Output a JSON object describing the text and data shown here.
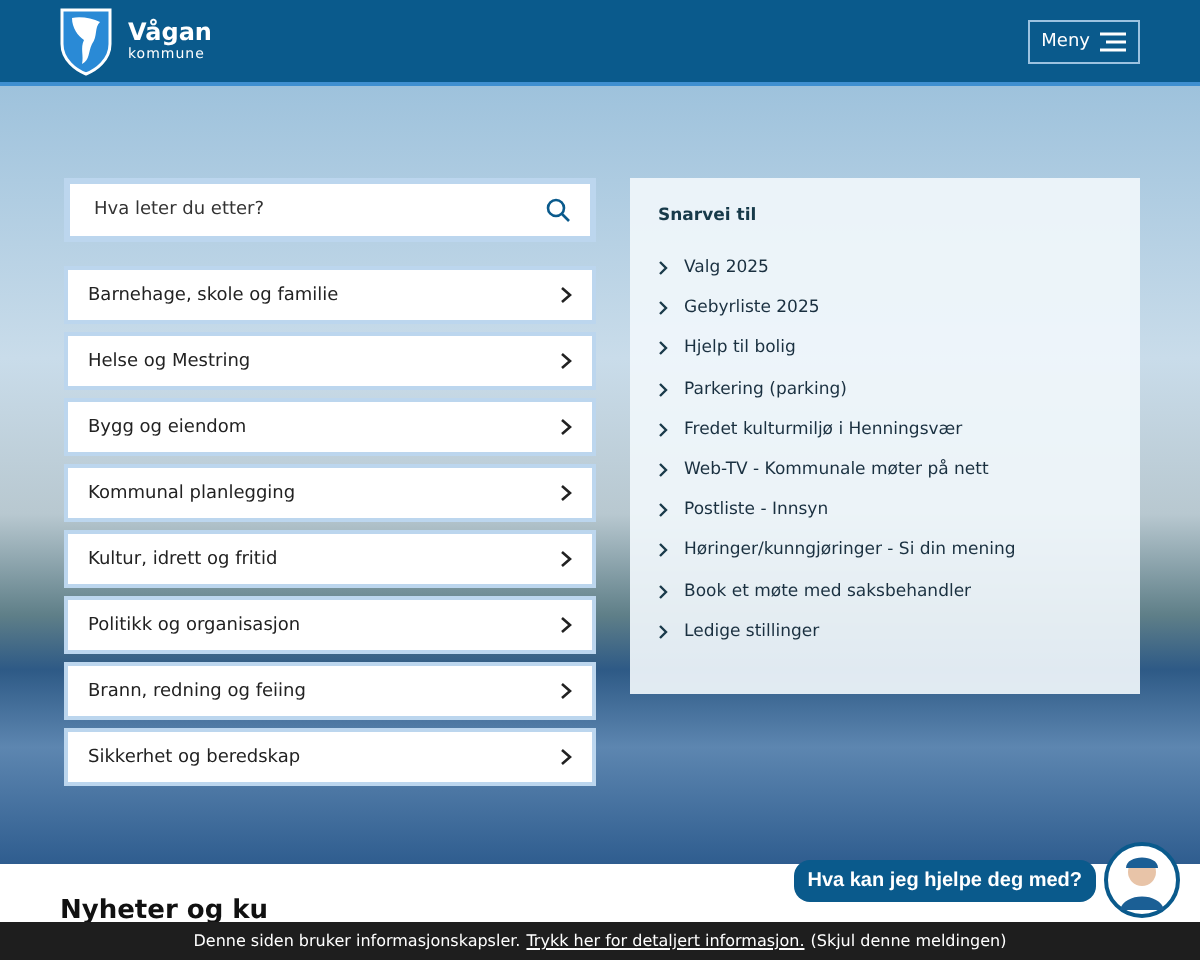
{
  "header": {
    "logo_name": "Vågan",
    "logo_sub": "kommune",
    "menu_button": "Meny"
  },
  "search": {
    "placeholder": "Hva leter du etter?"
  },
  "categories": [
    "Barnehage, skole og familie",
    "Helse og Mestring",
    "Bygg og eiendom",
    "Kommunal planlegging",
    "Kultur, idrett og fritid",
    "Politikk og organisasjon",
    "Brann, redning og feiing",
    "Sikkerhet og beredskap"
  ],
  "shortcuts": {
    "title": "Snarvei til",
    "links": [
      "Valg 2025",
      "Gebyrliste 2025",
      "Hjelp til bolig",
      "Parkering (parking)",
      "Fredet kulturmiljø i Henningsvær",
      "Web-TV - Kommunale møter på nett",
      "Postliste - Innsyn",
      "Høringer/kunngjøringer - Si din mening",
      "Book et møte med saksbehandler",
      "Ledige stillinger"
    ]
  },
  "news_heading": "Nyheter og ku",
  "chat": {
    "prompt": "Hva kan jeg hjelpe deg med?"
  },
  "cookie_bar": {
    "text": "Denne siden bruker informasjonskapsler.",
    "link": "Trykk her for detaljert informasjon.",
    "dismiss": "(Skjul denne meldingen)"
  }
}
